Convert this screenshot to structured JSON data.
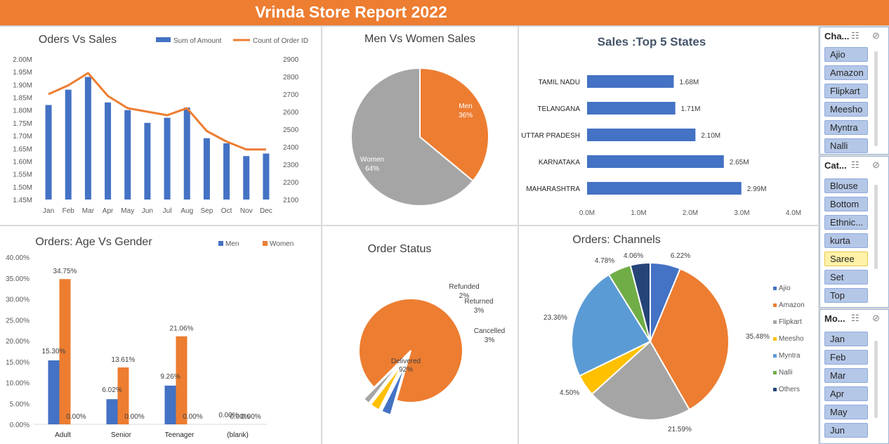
{
  "title": "Vrinda Store Report 2022",
  "colors": {
    "orange": "#ed7d31",
    "blue": "#4472c4",
    "gray": "#a5a5a5",
    "yellow": "#ffc000",
    "lightblue": "#5b9bd5",
    "green": "#70ad47",
    "navy": "#264478"
  },
  "chart_data": [
    {
      "id": "orders_vs_sales",
      "type": "bar",
      "title": "Oders Vs Sales",
      "categories": [
        "Jan",
        "Feb",
        "Mar",
        "Apr",
        "May",
        "Jun",
        "Jul",
        "Aug",
        "Sep",
        "Oct",
        "Nov",
        "Dec"
      ],
      "series": [
        {
          "name": "Sum of Amount",
          "type": "bar",
          "axis": "left",
          "values": [
            1.82,
            1.88,
            1.93,
            1.83,
            1.8,
            1.75,
            1.77,
            1.81,
            1.69,
            1.67,
            1.62,
            1.63
          ]
        },
        {
          "name": "Count of Order ID",
          "type": "line",
          "axis": "right",
          "values": [
            2700,
            2750,
            2820,
            2690,
            2620,
            2600,
            2580,
            2620,
            2490,
            2430,
            2385,
            2385
          ]
        }
      ],
      "y_left": {
        "ylim": [
          1.45,
          2.0
        ],
        "ticks": [
          "1.45M",
          "1.50M",
          "1.55M",
          "1.60M",
          "1.65M",
          "1.70M",
          "1.75M",
          "1.80M",
          "1.85M",
          "1.90M",
          "1.95M",
          "2.00M"
        ]
      },
      "y_right": {
        "ylim": [
          2100,
          2900
        ],
        "ticks": [
          "2100",
          "2200",
          "2300",
          "2400",
          "2500",
          "2600",
          "2700",
          "2800",
          "2900"
        ]
      },
      "legend": "top-right"
    },
    {
      "id": "men_vs_women",
      "type": "pie",
      "title": "Men Vs Women Sales",
      "slices": [
        {
          "label": "Men",
          "pct": "36%",
          "value": 36,
          "color": "#ed7d31"
        },
        {
          "label": "Women",
          "pct": "64%",
          "value": 64,
          "color": "#a5a5a5"
        }
      ]
    },
    {
      "id": "top5_states",
      "type": "bar",
      "orientation": "horizontal",
      "title": "Sales :Top 5 States",
      "categories": [
        "TAMIL NADU",
        "TELANGANA",
        "UTTAR PRADESH",
        "KARNATAKA",
        "MAHARASHTRA"
      ],
      "values": [
        1.68,
        1.71,
        2.1,
        2.65,
        2.99
      ],
      "data_labels": [
        "1.68M",
        "1.71M",
        "2.10M",
        "2.65M",
        "2.99M"
      ],
      "xlim": [
        0,
        4
      ],
      "x_ticks": [
        "0.0M",
        "1.0M",
        "2.0M",
        "3.0M",
        "4.0M"
      ]
    },
    {
      "id": "age_vs_gender",
      "type": "bar",
      "title": "Orders: Age Vs Gender",
      "categories": [
        "Adult",
        "Senior",
        "Teenager",
        "(blank)"
      ],
      "series": [
        {
          "name": "Men",
          "values": [
            15.3,
            6.02,
            9.26,
            0.0
          ],
          "labels": [
            "15.30%",
            "6.02%",
            "9.26%",
            "0.00%"
          ]
        },
        {
          "name": "Women",
          "values": [
            34.75,
            13.61,
            21.06,
            0.0
          ],
          "labels": [
            "34.75%",
            "13.61%",
            "21.06%",
            "0.00%"
          ]
        }
      ],
      "extra_labels": [
        "0.00%",
        "0.00%",
        "0.00%",
        "0.00%"
      ],
      "ylim": [
        0,
        40
      ],
      "y_ticks": [
        "0.00%",
        "5.00%",
        "10.00%",
        "15.00%",
        "20.00%",
        "25.00%",
        "30.00%",
        "35.00%",
        "40.00%"
      ],
      "legend": "top-right"
    },
    {
      "id": "order_status",
      "type": "pie",
      "title": "Order Status",
      "slices": [
        {
          "label": "Delivered",
          "pct": "92%",
          "value": 92,
          "color": "#ed7d31"
        },
        {
          "label": "Cancelled",
          "pct": "3%",
          "value": 3,
          "color": "#4472c4"
        },
        {
          "label": "Returned",
          "pct": "3%",
          "value": 3,
          "color": "#ffc000"
        },
        {
          "label": "Refunded",
          "pct": "2%",
          "value": 2,
          "color": "#a5a5a5"
        }
      ]
    },
    {
      "id": "channels",
      "type": "pie",
      "title": "Orders: Channels",
      "slices": [
        {
          "label": "Ajio",
          "pct": "6.22%",
          "value": 6.22,
          "color": "#4472c4"
        },
        {
          "label": "Amazon",
          "pct": "35.48%",
          "value": 35.48,
          "color": "#ed7d31"
        },
        {
          "label": "Flipkart",
          "pct": "21.59%",
          "value": 21.59,
          "color": "#a5a5a5"
        },
        {
          "label": "Meesho",
          "pct": "4.50%",
          "value": 4.5,
          "color": "#ffc000"
        },
        {
          "label": "Myntra",
          "pct": "23.36%",
          "value": 23.36,
          "color": "#5b9bd5"
        },
        {
          "label": "Nalli",
          "pct": "4.78%",
          "value": 4.78,
          "color": "#70ad47"
        },
        {
          "label": "Others",
          "pct": "4.06%",
          "value": 4.06,
          "color": "#264478"
        }
      ],
      "legend": "right"
    }
  ],
  "slicers": [
    {
      "title": "Cha...",
      "items": [
        "Ajio",
        "Amazon",
        "Flipkart",
        "Meesho",
        "Myntra",
        "Nalli"
      ],
      "selected": []
    },
    {
      "title": "Cat...",
      "items": [
        "Blouse",
        "Bottom",
        "Ethnic...",
        "kurta",
        "Saree",
        "Set",
        "Top"
      ],
      "selected": [
        "Saree"
      ]
    },
    {
      "title": "Mo...",
      "items": [
        "Jan",
        "Feb",
        "Mar",
        "Apr",
        "May",
        "Jun"
      ],
      "selected": []
    }
  ]
}
